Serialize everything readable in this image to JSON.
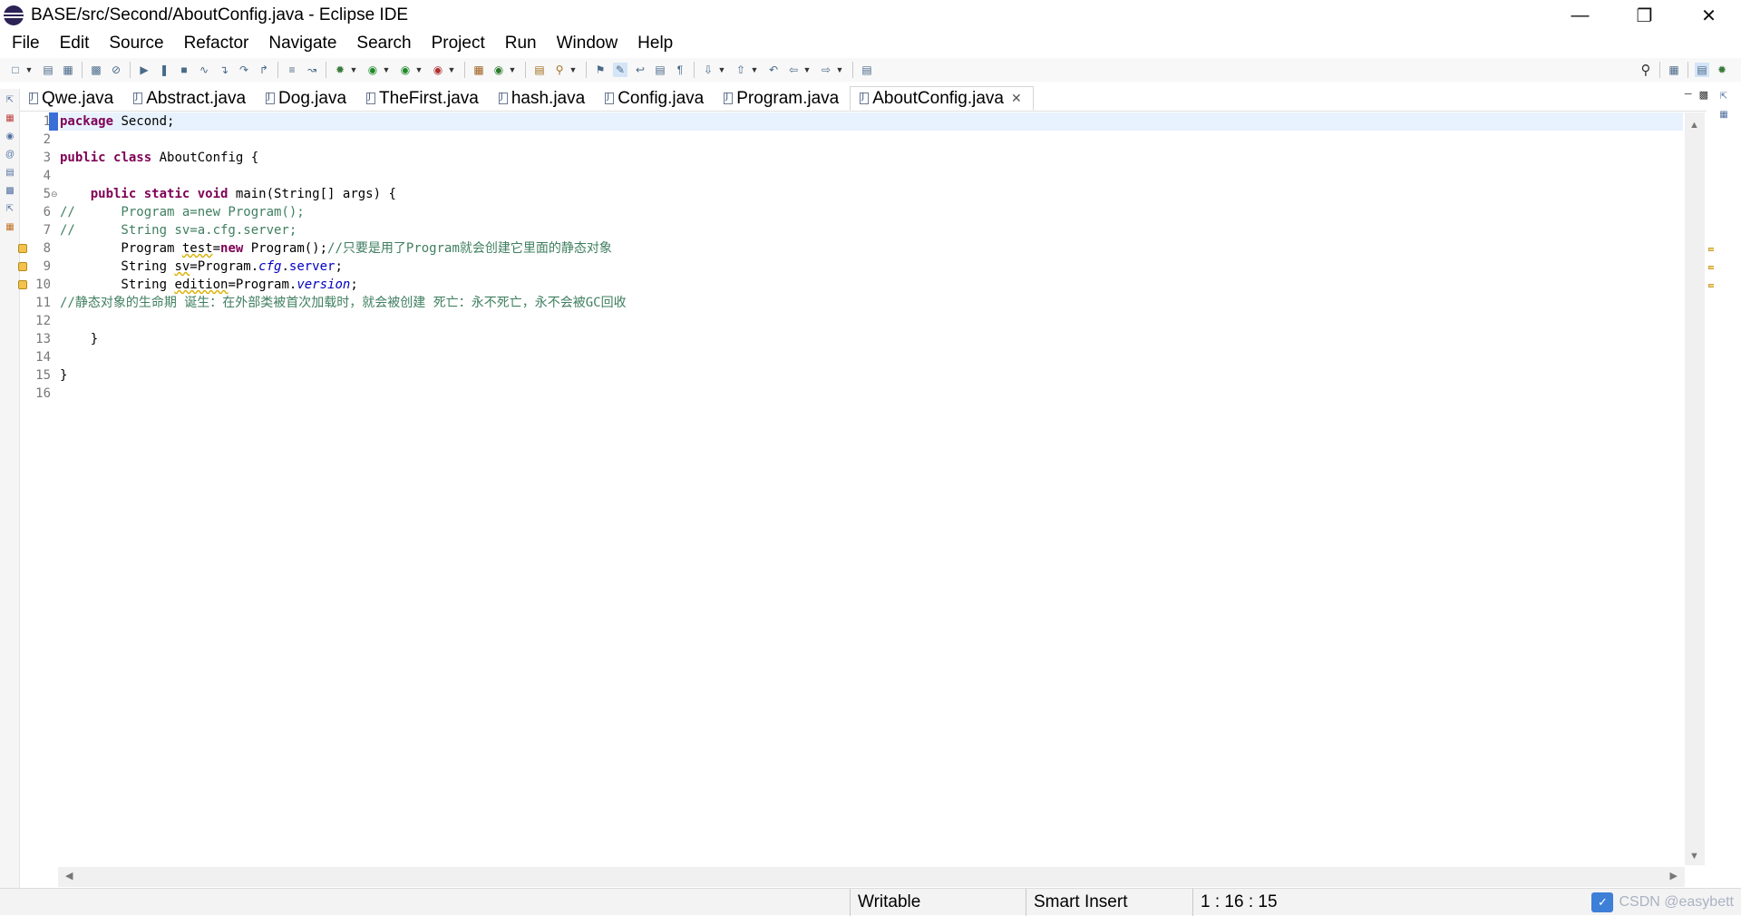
{
  "window": {
    "title": "BASE/src/Second/AboutConfig.java - Eclipse IDE",
    "controls": [
      "minimize",
      "restore",
      "close"
    ]
  },
  "menu": [
    "File",
    "Edit",
    "Source",
    "Refactor",
    "Navigate",
    "Search",
    "Project",
    "Run",
    "Window",
    "Help"
  ],
  "tabs": [
    {
      "label": "Qwe.java",
      "active": false
    },
    {
      "label": "Abstract.java",
      "active": false
    },
    {
      "label": "Dog.java",
      "active": false
    },
    {
      "label": "TheFirst.java",
      "active": false
    },
    {
      "label": "hash.java",
      "active": false
    },
    {
      "label": "Config.java",
      "active": false
    },
    {
      "label": "Program.java",
      "active": false
    },
    {
      "label": "AboutConfig.java",
      "active": true
    }
  ],
  "editor": {
    "lines": [
      {
        "n": "1",
        "text": "package Second;"
      },
      {
        "n": "2",
        "text": ""
      },
      {
        "n": "3",
        "text": "public class AboutConfig {"
      },
      {
        "n": "4",
        "text": ""
      },
      {
        "n": "5",
        "text": "    public static void main(String[] args) {"
      },
      {
        "n": "6",
        "text": "//      Program a=new Program();"
      },
      {
        "n": "7",
        "text": "//      String sv=a.cfg.server;"
      },
      {
        "n": "8",
        "text": "        Program test=new Program();//只要是用了Program就会创建它里面的静态对象"
      },
      {
        "n": "9",
        "text": "        String sv=Program.cfg.server;"
      },
      {
        "n": "10",
        "text": "        String edition=Program.version;"
      },
      {
        "n": "11",
        "text": "//静态对象的生命期 诞生：在外部类被首次加载时，就会被创建 死亡：永不死亡，永不会被GC回收"
      },
      {
        "n": "12",
        "text": ""
      },
      {
        "n": "13",
        "text": "    }"
      },
      {
        "n": "14",
        "text": ""
      },
      {
        "n": "15",
        "text": "}"
      },
      {
        "n": "16",
        "text": ""
      }
    ]
  },
  "status": {
    "writable": "Writable",
    "insert_mode": "Smart Insert",
    "position": "1 : 16 : 15"
  },
  "watermark": "CSDN @easybett"
}
